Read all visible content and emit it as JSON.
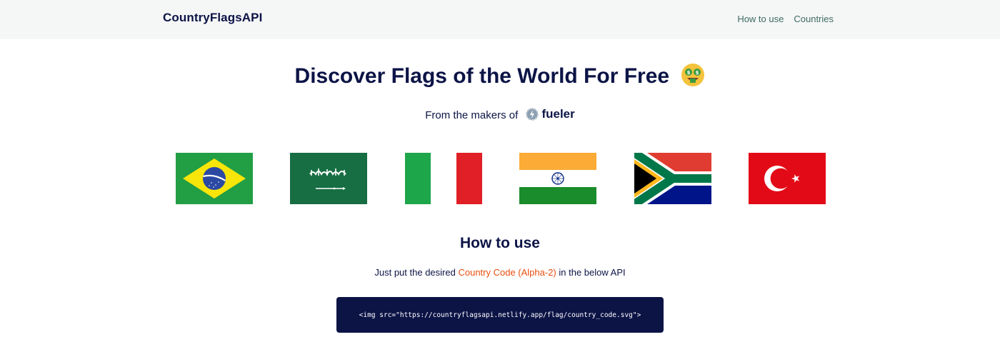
{
  "header": {
    "brand": "CountryFlagsAPI",
    "nav": [
      {
        "label": "How to use"
      },
      {
        "label": "Countries"
      }
    ]
  },
  "hero": {
    "title": "Discover Flags of the World For Free",
    "emoji_icon": "money-mouth-face-icon",
    "makers_prefix": "From the makers of",
    "makers_brand": "fueler"
  },
  "flags": [
    {
      "country": "Brazil",
      "icon": "brazil-flag-icon"
    },
    {
      "country": "Saudi Arabia",
      "icon": "saudi-arabia-flag-icon"
    },
    {
      "country": "Italy",
      "icon": "italy-flag-icon"
    },
    {
      "country": "India",
      "icon": "india-flag-icon"
    },
    {
      "country": "South Africa",
      "icon": "south-africa-flag-icon"
    },
    {
      "country": "Turkey",
      "icon": "turkey-flag-icon"
    }
  ],
  "how_to_use": {
    "title": "How to use",
    "desc_prefix": "Just put the desired",
    "desc_link": "Country Code (Alpha-2)",
    "desc_suffix": "in the below API",
    "code": "<img src=\"https://countryflagsapi.netlify.app/flag/country_code.svg\">"
  },
  "colors": {
    "navy": "#0c1446",
    "accent": "#e84e0f",
    "nav_link": "#3e6b63",
    "header_bg": "#f5f6f6"
  }
}
